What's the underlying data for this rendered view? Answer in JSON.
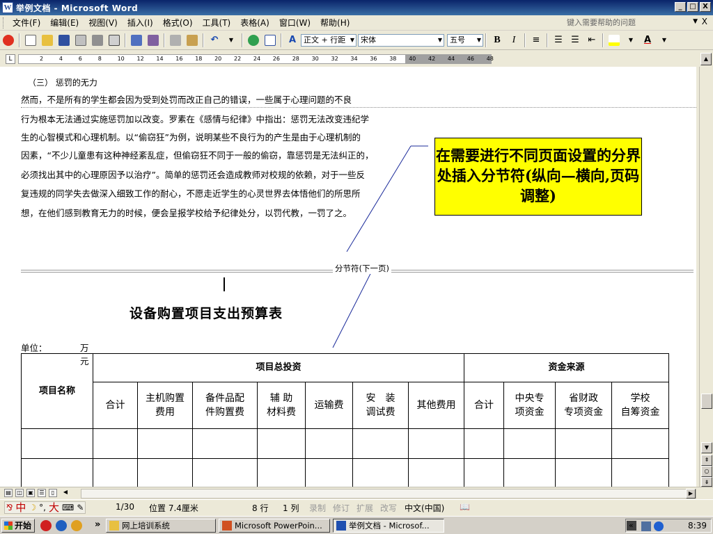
{
  "window": {
    "title": "举例文档 - Microsoft Word",
    "minimize": "_",
    "restore": "□",
    "close": "X"
  },
  "menu": {
    "items": [
      "文件(F)",
      "编辑(E)",
      "视图(V)",
      "插入(I)",
      "格式(O)",
      "工具(T)",
      "表格(A)",
      "窗口(W)",
      "帮助(H)"
    ],
    "help_placeholder": "键入需要帮助的问题",
    "close_doc": "X"
  },
  "toolbar": {
    "style_value": "正文 + 行距",
    "font_value": "宋体",
    "size_value": "五号",
    "bold": "B",
    "italic": "I"
  },
  "ruler": {
    "ticks": [
      "2",
      "4",
      "6",
      "8",
      "10",
      "12",
      "14",
      "16",
      "18",
      "20",
      "22",
      "24",
      "26",
      "28",
      "30",
      "32",
      "34",
      "36",
      "38",
      "40",
      "42",
      "44",
      "46",
      "48"
    ]
  },
  "document": {
    "heading": "（三） 惩罚的无力",
    "lines": [
      "    然而，不是所有的学生都会因为受到处罚而改正自己的错误，一些属于心理问题的不良",
      "行为根本无法通过实施惩罚加以改变。罗素在《感情与纪律》中指出：惩罚无法改变违纪学",
      "生的心智模式和心理机制。以“偷窃狂”为例，说明某些不良行为的产生是由于心理机制的",
      "因素，“不少儿童患有这种神经紊乱症，但偷窃狂不同于一般的偷窃，靠惩罚是无法纠正的，",
      "必须找出其中的心理原因予以治疗”。简单的惩罚还会造成教师对校规的依赖，对于一些反",
      "复违规的同学失去做深入细致工作的耐心，不愿走近学生的心灵世界去体悟他们的所思所",
      "想，在他们感到教育无力的时候，便会呈报学校给予纪律处分，以罚代教，一罚了之。"
    ],
    "callout": "在需要进行不同页面设置的分界处插入分节符(纵向—横向,页码调整)",
    "section_break": "分节符(下一页)",
    "table_title": "设备购置项目支出预算表",
    "unit_label": "单位：",
    "unit_value": "万元",
    "table": {
      "col_project_name": "项目名称",
      "group_total": "项目总投资",
      "group_source": "资金来源",
      "total_subheaders": [
        "合计",
        "主机购置\n费用",
        "备件品配\n件购置费",
        "辅 助\n材料费",
        "运输费",
        "安　装\n调试费",
        "其他费用"
      ],
      "source_subheaders": [
        "合计",
        "中央专\n项资金",
        "省财政\n专项资金",
        "学校\n自筹资金"
      ]
    }
  },
  "status": {
    "page": "1/30",
    "position": "位置 7.4厘米",
    "line": "8 行",
    "col": "1 列",
    "rec": "录制",
    "trk": "修订",
    "ext": "扩展",
    "ovr": "改写",
    "lang": "中文(中国)",
    "ime": "中",
    "ime_wide": "大"
  },
  "taskbar": {
    "start": "开始",
    "chevron": "»",
    "tasks": [
      "网上培训系统",
      "Microsoft PowerPoin...",
      "举例文档 - Microsof..."
    ],
    "tray_chevron": "«",
    "clock": "8:39"
  },
  "colors": {
    "callout_bg": "#ffff00",
    "titlebar": "#0a246a",
    "ime_red": "#c00000"
  }
}
